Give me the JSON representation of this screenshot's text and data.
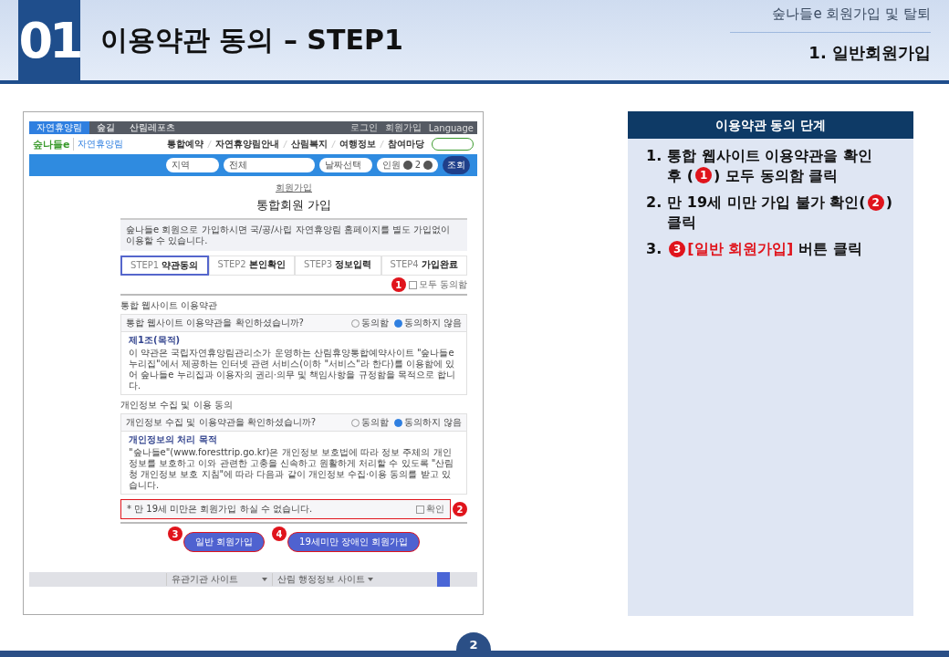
{
  "header": {
    "number": "01",
    "title": "이용약관 동의 – STEP1",
    "category": "숲나들e 회원가입 및 탈퇴",
    "section": "1. 일반회원가입"
  },
  "site": {
    "top_tabs": [
      {
        "label": "자연휴양림",
        "selected": true
      },
      {
        "label": "숲길",
        "selected": false
      },
      {
        "label": "산림레포츠",
        "selected": false
      }
    ],
    "top_links": [
      "로그인",
      "회원가입",
      "Language"
    ],
    "logo": "숲나들e",
    "brand": "자연휴양림",
    "nav": [
      "통합예약",
      "자연휴양림안내",
      "산림복지",
      "여행정보",
      "참여마당"
    ],
    "search": {
      "region": "지역",
      "area": "전체",
      "date": "날짜선택",
      "people_label": "인원",
      "people": "2",
      "submit": "조회"
    },
    "breadcrumb": "회원가입",
    "page_title": "통합회원 가입",
    "notice": "숲나들e 회원으로 가입하시면 국/공/사립 자연휴양림 홈페이지를 별도 가입없이 이용할 수 있습니다.",
    "steps": [
      {
        "step": "STEP1",
        "label": "약관동의",
        "selected": true
      },
      {
        "step": "STEP2",
        "label": "본인확인",
        "selected": false
      },
      {
        "step": "STEP3",
        "label": "정보입력",
        "selected": false
      },
      {
        "step": "STEP4",
        "label": "가입완료",
        "selected": false
      }
    ],
    "agree_all": {
      "label": "모두 동의함",
      "checked": false,
      "marker": "1"
    },
    "sections": [
      {
        "title": "통합 웹사이트 이용약관",
        "question": "통합 웹사이트 이용약관을 확인하셨습니까?",
        "options": [
          {
            "label": "동의함",
            "selected": false
          },
          {
            "label": "동의하지 않음",
            "selected": true
          }
        ],
        "heading": "제1조(목적)",
        "body": "이 약관은 국립자연휴양림관리소가 운영하는 산림휴양통합예약사이트 \"숲나들e 누리집\"에서 제공하는 인터넷 관련 서비스(이하 \"서비스\"라 한다)를 이용함에 있어 숲나들e 누리집과 이용자의 권리·의무 및 책임사항을 규정함을 목적으로 합니다."
      },
      {
        "title": "개인정보 수집 및 이용 동의",
        "question": "개인정보 수집 및 이용약관을 확인하셨습니까?",
        "options": [
          {
            "label": "동의함",
            "selected": false
          },
          {
            "label": "동의하지 않음",
            "selected": true
          }
        ],
        "heading": "개인정보의 처리 목적",
        "body": "\"숲나들e\"(www.foresttrip.go.kr)은 개인정보 보호법에 따라 정보 주체의 개인정보를 보호하고 이와 관련한 고충을 신속하고 원활하게 처리할 수 있도록 \"산림청 개인정보 보호 지침\"에 따라 다음과 같이 개인정보 수집·이용 동의를 받고 있습니다."
      }
    ],
    "age_notice": {
      "text": "* 만 19세 미만은 회원가입 하실 수 없습니다.",
      "confirm": "확인",
      "checked": false,
      "marker": "2"
    },
    "buttons": [
      {
        "label": "일반 회원가입",
        "marker": "3"
      },
      {
        "label": "19세미만 장애인 회원가입",
        "marker": "4"
      }
    ],
    "footer": [
      "유관기관 사이트",
      "산림 행정정보 사이트"
    ]
  },
  "panel": {
    "title": "이용약관 동의 단계",
    "steps": [
      {
        "number": "1.",
        "lines": [
          [
            {
              "kind": "text",
              "text": "통합 웹사이트 이용약관을 확인"
            }
          ],
          [
            {
              "kind": "text",
              "text": "후 ("
            },
            {
              "kind": "marker",
              "text": "1"
            },
            {
              "kind": "text",
              "text": ") 모두 동의함 클릭"
            }
          ]
        ]
      },
      {
        "number": "2.",
        "lines": [
          [
            {
              "kind": "text",
              "text": "만 19세 미만 가입 불가 확인("
            },
            {
              "kind": "marker",
              "text": "2"
            },
            {
              "kind": "text",
              "text": ")"
            }
          ],
          [
            {
              "kind": "text",
              "text": "클릭"
            }
          ]
        ]
      },
      {
        "number": "3.",
        "lines": [
          [
            {
              "kind": "marker",
              "text": "3"
            },
            {
              "kind": "highlight",
              "text": "[일반 회원가입]"
            },
            {
              "kind": "text",
              "text": " 버튼 클릭"
            }
          ]
        ]
      }
    ]
  },
  "page_number": "2"
}
